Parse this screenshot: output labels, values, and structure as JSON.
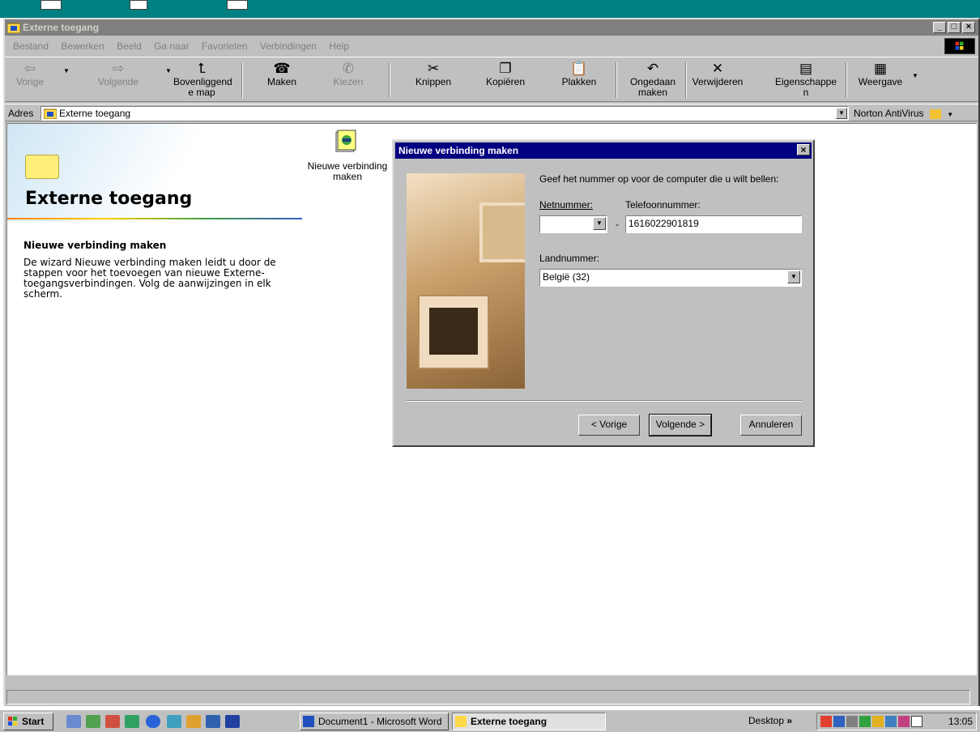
{
  "window": {
    "title": "Externe toegang",
    "menu": [
      "Bestand",
      "Bewerken",
      "Beeld",
      "Ga naar",
      "Favorieten",
      "Verbindingen",
      "Help"
    ]
  },
  "toolbar": {
    "back": "Vorige",
    "forward": "Volgende",
    "up_line1": "Bovenliggend",
    "up_line2": "e map",
    "create": "Maken",
    "dial": "Kiezen",
    "cut": "Knippen",
    "copy": "Kopiëren",
    "paste": "Plakken",
    "undo_line1": "Ongedaan",
    "undo_line2": "maken",
    "delete": "Verwijderen",
    "properties_line1": "Eigenschappe",
    "properties_line2": "n",
    "views": "Weergave"
  },
  "address": {
    "label": "Adres",
    "value": "Externe toegang",
    "norton": "Norton AntiVirus"
  },
  "content": {
    "heading": "Externe toegang",
    "subheading": "Nieuwe verbinding maken",
    "description": "De wizard Nieuwe verbinding maken leidt u door de stappen voor het toevoegen van nieuwe Externe-toegangsverbindingen. Volg de aanwijzingen in elk scherm.",
    "file_icon_line1": "Nieuwe verbinding",
    "file_icon_line2": "maken"
  },
  "dialog": {
    "title": "Nieuwe verbinding maken",
    "prompt": "Geef het nummer op voor de computer die u wilt bellen:",
    "area_code_label": "Netnummer:",
    "area_code_value": "",
    "dash": "-",
    "phone_label": "Telefoonnummer:",
    "phone_value": "1616022901819",
    "country_label": "Landnummer:",
    "country_value": "België (32)",
    "back_button": "< Vorige",
    "next_button": "Volgende >",
    "cancel_button": "Annuleren"
  },
  "taskbar": {
    "start": "Start",
    "tasks": [
      "Document1 - Microsoft Word",
      "Externe toegang"
    ],
    "desktop": "Desktop",
    "chevron": "»",
    "clock": "13:05"
  }
}
